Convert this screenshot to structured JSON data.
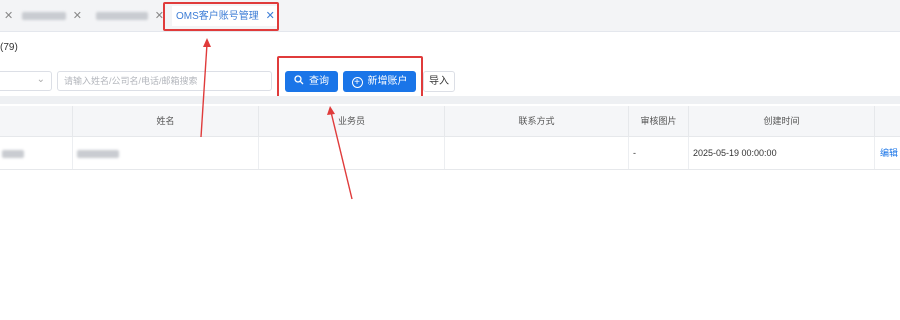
{
  "tabs": [
    {
      "label": "",
      "close": "✕"
    },
    {
      "label": "",
      "close": "✕"
    },
    {
      "label": "",
      "close": "✕"
    },
    {
      "label": "OMS客户账号管理",
      "close": "✕",
      "active": true
    }
  ],
  "record_count": "(79)",
  "toolbar": {
    "search_placeholder": "请输入姓名/公司名/电话/邮箱搜索",
    "query_label": "查询",
    "add_account_label": "新增账户",
    "import_label": "导入"
  },
  "table": {
    "columns": [
      "姓名",
      "业务员",
      "联系方式",
      "审核图片",
      "创建时间"
    ],
    "rows": [
      {
        "name": "",
        "salesperson": "",
        "contact": "",
        "audit_image": "-",
        "created": "2025-05-19 00:00:00",
        "action": "编辑"
      }
    ]
  },
  "colors": {
    "accent": "#1a75e8",
    "annotation": "#e03b3b",
    "tab_active": "#3d7dd6"
  }
}
